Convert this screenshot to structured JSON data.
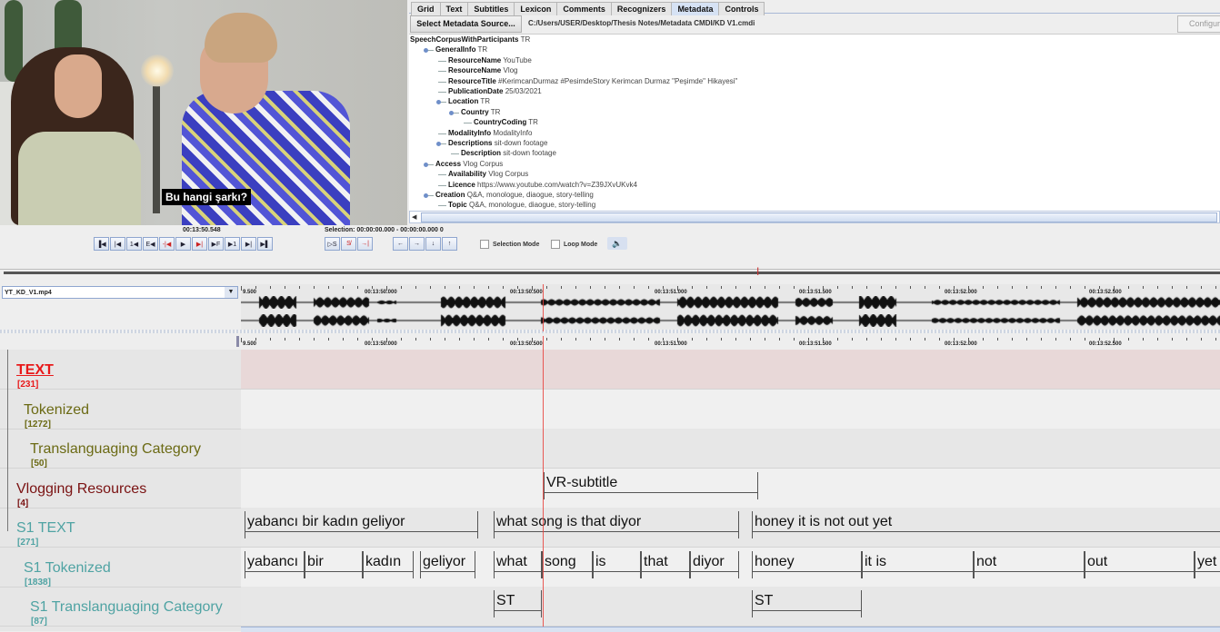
{
  "video": {
    "subtitle": "Bu hangi şarkı?"
  },
  "tabs": [
    {
      "label": "Grid",
      "active": false
    },
    {
      "label": "Text",
      "active": false
    },
    {
      "label": "Subtitles",
      "active": false
    },
    {
      "label": "Lexicon",
      "active": false
    },
    {
      "label": "Comments",
      "active": false
    },
    {
      "label": "Recognizers",
      "active": false
    },
    {
      "label": "Metadata",
      "active": true
    },
    {
      "label": "Controls",
      "active": false
    }
  ],
  "metadata": {
    "select_button": "Select Metadata Source...",
    "path": "C:/Users/USER/Desktop/Thesis Notes/Metadata CMDI/KD V1.cmdi",
    "configure_button": "Configure",
    "tree": [
      {
        "key": "SpeechCorpusWithParticipants",
        "value": "TR",
        "level": 0,
        "expandable": false
      },
      {
        "key": "GeneralInfo",
        "value": "TR",
        "level": 1,
        "expandable": true
      },
      {
        "key": "ResourceName",
        "value": "YouTube",
        "level": 2,
        "expandable": false
      },
      {
        "key": "ResourceName",
        "value": "Vlog",
        "level": 2,
        "expandable": false
      },
      {
        "key": "ResourceTitle",
        "value": "#KerimcanDurmaz #PesimdeStory Kerimcan Durmaz \"Peşimde\" Hikayesi\"",
        "level": 2,
        "expandable": false
      },
      {
        "key": "PublicationDate",
        "value": "25/03/2021",
        "level": 2,
        "expandable": false
      },
      {
        "key": "Location",
        "value": "TR",
        "level": 2,
        "expandable": true
      },
      {
        "key": "Country",
        "value": "TR",
        "level": 3,
        "expandable": true
      },
      {
        "key": "CountryCoding",
        "value": "TR",
        "level": 4,
        "expandable": false
      },
      {
        "key": "ModalityInfo",
        "value": "ModalityInfo",
        "level": 2,
        "expandable": false
      },
      {
        "key": "Descriptions",
        "value": "sit-down footage",
        "level": 2,
        "expandable": true
      },
      {
        "key": "Description",
        "value": "sit-down footage",
        "level": 3,
        "expandable": false
      },
      {
        "key": "Access",
        "value": "Vlog Corpus",
        "level": 1,
        "expandable": true
      },
      {
        "key": "Availability",
        "value": "Vlog Corpus",
        "level": 2,
        "expandable": false
      },
      {
        "key": "Licence",
        "value": "https://www.youtube.com/watch?v=Z39JXvUKvk4",
        "level": 2,
        "expandable": false
      },
      {
        "key": "Creation",
        "value": "Q&A, monologue, diaogue, story-telling",
        "level": 1,
        "expandable": true
      },
      {
        "key": "Topic",
        "value": "Q&A, monologue, diaogue, story-telling",
        "level": 2,
        "expandable": false
      }
    ]
  },
  "player": {
    "current_time": "00:13:50.548",
    "selection": "Selection: 00:00:00.000 - 00:00:00.000  0",
    "nav_buttons": [
      {
        "name": "go-to-begin",
        "glyph": "▐◀"
      },
      {
        "name": "previous-frame",
        "glyph": "|◀"
      },
      {
        "name": "previous-second",
        "glyph": "1◀"
      },
      {
        "name": "previous-pixel",
        "glyph": "E◀"
      },
      {
        "name": "previous-boundary",
        "glyph": "-|◀"
      },
      {
        "name": "play",
        "glyph": "▶"
      },
      {
        "name": "next-boundary",
        "glyph": "▶|"
      },
      {
        "name": "next-pixel",
        "glyph": "▶F"
      },
      {
        "name": "next-second",
        "glyph": "▶1"
      },
      {
        "name": "next-frame",
        "glyph": "▶|"
      },
      {
        "name": "go-to-end",
        "glyph": "▶▌"
      }
    ],
    "selection_buttons": [
      {
        "name": "play-selection",
        "glyph": "▷S"
      },
      {
        "name": "clear-selection",
        "glyph": "S̸"
      },
      {
        "name": "toggle-boundary",
        "glyph": "→|"
      }
    ],
    "arrow_buttons": [
      {
        "name": "left",
        "glyph": "←"
      },
      {
        "name": "right",
        "glyph": "→"
      },
      {
        "name": "down",
        "glyph": "↓"
      },
      {
        "name": "up",
        "glyph": "↑"
      }
    ],
    "selection_mode_label": "Selection Mode",
    "loop_mode_label": "Loop Mode",
    "volume_glyph": "🔈"
  },
  "waveform": {
    "media_file": "YT_KD_V1.mp4",
    "ruler_labels": [
      "9.500",
      "00:13:50.000",
      "00:13:50.500",
      "00:13:51.000",
      "00:13:51.500",
      "00:13:52.000",
      "00:13:52.500"
    ]
  },
  "tiers": [
    {
      "name": "TEXT",
      "count": "[231]",
      "color": "#e8191a",
      "indent": 0,
      "active": true
    },
    {
      "name": "Tokenized",
      "count": "[1272]",
      "color": "#6b6a14",
      "indent": 1
    },
    {
      "name": "Translanguaging Category",
      "count": "[50]",
      "color": "#6b6a14",
      "indent": 2
    },
    {
      "name": "Vlogging Resources",
      "count": "[4]",
      "color": "#7a1212",
      "indent": 0
    },
    {
      "name": "S1 TEXT",
      "count": "[271]",
      "color": "#4fa3a3",
      "indent": 0
    },
    {
      "name": "S1 Tokenized",
      "count": "[1838]",
      "color": "#4fa3a3",
      "indent": 1
    },
    {
      "name": "S1 Translanguaging Category",
      "count": "[87]",
      "color": "#4fa3a3",
      "indent": 2
    }
  ],
  "annotations": {
    "vlogging_resources": [
      {
        "text": "VR-subtitle"
      }
    ],
    "s1_text": [
      {
        "text": "yabancı bir kadın geliyor"
      },
      {
        "text": "what song is that diyor"
      },
      {
        "text": "honey it is not out yet"
      }
    ],
    "s1_tokenized": [
      {
        "text": "yabancı"
      },
      {
        "text": "bir"
      },
      {
        "text": "kadın"
      },
      {
        "text": "geliyor"
      },
      {
        "text": "what"
      },
      {
        "text": "song"
      },
      {
        "text": "is"
      },
      {
        "text": "that"
      },
      {
        "text": "diyor"
      },
      {
        "text": "honey"
      },
      {
        "text": "it is"
      },
      {
        "text": "not"
      },
      {
        "text": "out"
      },
      {
        "text": "yet"
      }
    ],
    "s1_translanguaging": [
      {
        "text": "ST"
      },
      {
        "text": "ST"
      }
    ]
  }
}
